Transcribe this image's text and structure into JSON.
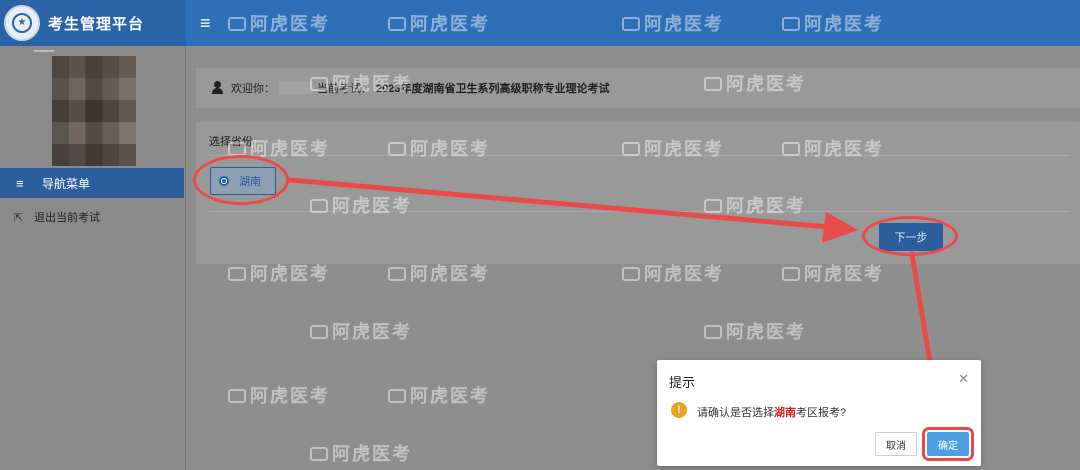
{
  "app": {
    "title": "考生管理平台"
  },
  "sidebar": {
    "nav_header": "导航菜单",
    "items": [
      {
        "label": "退出当前考试"
      }
    ]
  },
  "welcome": {
    "label": "欢迎你：",
    "exam_label": "当前考试：",
    "exam_name": "2023年度湖南省卫生系列高级职称专业理论考试"
  },
  "province_panel": {
    "title": "选择省份",
    "options": [
      {
        "label": "湖南",
        "selected": true
      }
    ],
    "next_button": "下一步"
  },
  "dialog": {
    "title": "提示",
    "message_prefix": "请确认是否选择",
    "message_highlight": "湖南",
    "message_suffix": "考区报考?",
    "cancel": "取消",
    "ok": "确定"
  },
  "watermark": "阿虎医考",
  "colors": {
    "header": "#2f6fb8",
    "nav_active": "#2a5e9d",
    "annotation": "#ea4a4a",
    "ok_button": "#4e9ee6",
    "warning": "#f0a020"
  }
}
